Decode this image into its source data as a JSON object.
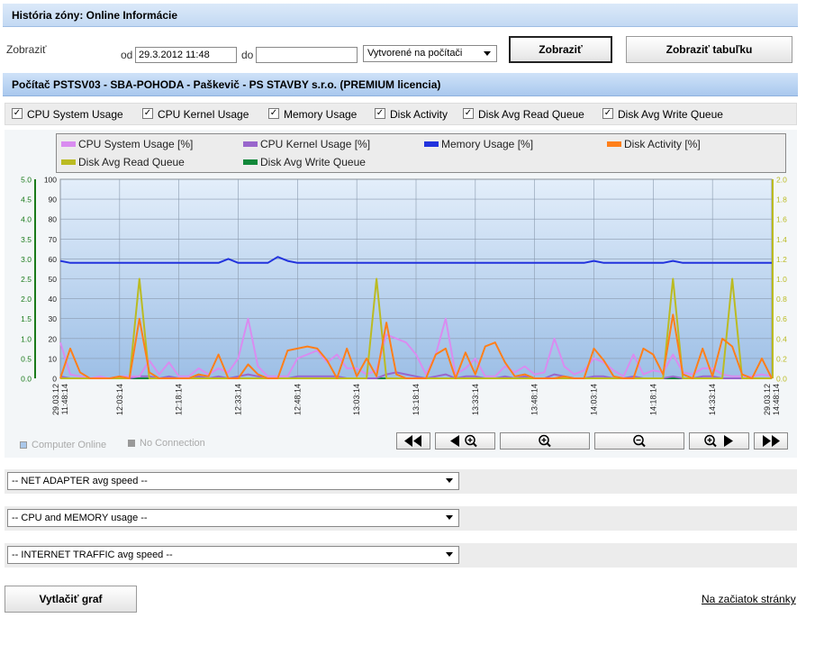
{
  "header": {
    "title": "História zóny: Online Informácie"
  },
  "filter": {
    "show_label": "Zobraziť",
    "from_label": "od",
    "from_value": "29.3.2012 11:48",
    "to_label": "do",
    "to_value": "",
    "mode_select": "Vytvorené na počítači",
    "show_button": "Zobraziť",
    "table_button": "Zobraziť tabuľku"
  },
  "computer": {
    "title": "Počítač PSTSV03 - SBA-POHODA - Paškevič - PS STAVBY s.r.o. (PREMIUM licencia)"
  },
  "checkboxes": [
    {
      "label": "CPU System Usage",
      "checked": true
    },
    {
      "label": "CPU Kernel Usage",
      "checked": true
    },
    {
      "label": "Memory Usage",
      "checked": true
    },
    {
      "label": "Disk Activity",
      "checked": true
    },
    {
      "label": "Disk Avg Read Queue",
      "checked": true
    },
    {
      "label": "Disk Avg Write Queue",
      "checked": true
    }
  ],
  "check_mark": "✓",
  "status": {
    "online": "Computer Online",
    "no_connection": "No Connection"
  },
  "colors": {
    "cpu_system": "#d98cf0",
    "cpu_kernel": "#9966cc",
    "memory": "#2233dd",
    "disk_activity": "#ff7f1a",
    "disk_read": "#bbbb22",
    "disk_write": "#11883a",
    "left_axis": "#1a7a1a",
    "right_axis": "#bbbb22"
  },
  "chart_data": {
    "type": "line",
    "legend": [
      "CPU System Usage [%]",
      "CPU Kernel Usage [%]",
      "Memory Usage [%]",
      "Disk Activity [%]",
      "Disk Avg Read Queue",
      "Disk Avg Write Queue"
    ],
    "left_axis_ticks": [
      "0.0",
      "0.5",
      "1.0",
      "1.5",
      "2.0",
      "2.5",
      "3.0",
      "3.5",
      "4.0",
      "4.5",
      "5.0"
    ],
    "percent_axis_ticks": [
      "0",
      "10",
      "20",
      "30",
      "40",
      "50",
      "60",
      "70",
      "80",
      "90",
      "100"
    ],
    "right_axis_ticks": [
      "0.0",
      "0.2",
      "0.4",
      "0.6",
      "0.8",
      "1.0",
      "1.2",
      "1.4",
      "1.6",
      "1.8",
      "2.0"
    ],
    "x_ticks": [
      "29.03.12 11:48:14",
      "12:03:14",
      "12:18:14",
      "12:33:14",
      "12:48:14",
      "13:03:14",
      "13:18:14",
      "13:33:14",
      "13:48:14",
      "14:03:14",
      "14:18:14",
      "14:33:14",
      "29.03.12 14:48:14"
    ],
    "ylim": [
      0,
      100
    ],
    "grid": true,
    "series": [
      {
        "name": "CPU System Usage [%]",
        "key": "cpu_system",
        "axis": "percent",
        "values": [
          18,
          2,
          1,
          0,
          1,
          0,
          1,
          1,
          1,
          9,
          2,
          8,
          1,
          1,
          5,
          2,
          5,
          3,
          10,
          30,
          6,
          1,
          1,
          1,
          10,
          12,
          14,
          8,
          12,
          5,
          5,
          2,
          4,
          22,
          20,
          18,
          12,
          2,
          12,
          30,
          2,
          5,
          10,
          1,
          1,
          6,
          3,
          6,
          2,
          3,
          20,
          6,
          2,
          4,
          10,
          8,
          4,
          1,
          12,
          2,
          4,
          3,
          12,
          3,
          2,
          5,
          5,
          2,
          1,
          1,
          1,
          2,
          1
        ]
      },
      {
        "name": "CPU Kernel Usage [%]",
        "key": "cpu_kernel",
        "axis": "percent",
        "values": [
          1,
          0,
          0,
          0,
          0,
          0,
          1,
          0,
          1,
          1,
          0,
          1,
          0,
          0,
          1,
          0,
          1,
          0,
          1,
          2,
          1,
          0,
          0,
          0,
          1,
          1,
          1,
          1,
          1,
          0,
          0,
          0,
          0,
          2,
          3,
          2,
          1,
          0,
          1,
          2,
          0,
          1,
          1,
          0,
          0,
          1,
          0,
          1,
          0,
          0,
          2,
          1,
          0,
          0,
          1,
          1,
          0,
          0,
          1,
          0,
          0,
          0,
          1,
          0,
          0,
          1,
          1,
          0,
          0,
          0,
          0,
          0,
          0
        ]
      },
      {
        "name": "Memory Usage [%]",
        "key": "memory",
        "axis": "percent",
        "values": [
          59,
          58,
          58,
          58,
          58,
          58,
          58,
          58,
          58,
          58,
          58,
          58,
          58,
          58,
          58,
          58,
          58,
          60,
          58,
          58,
          58,
          58,
          61,
          59,
          58,
          58,
          58,
          58,
          58,
          58,
          58,
          58,
          58,
          58,
          58,
          58,
          58,
          58,
          58,
          58,
          58,
          58,
          58,
          58,
          58,
          58,
          58,
          58,
          58,
          58,
          58,
          58,
          58,
          58,
          59,
          58,
          58,
          58,
          58,
          58,
          58,
          58,
          59,
          58,
          58,
          58,
          58,
          58,
          58,
          58,
          58,
          58,
          58
        ]
      },
      {
        "name": "Disk Activity [%]",
        "key": "disk_activity",
        "axis": "percent",
        "values": [
          0,
          15,
          3,
          0,
          0,
          0,
          1,
          0,
          30,
          3,
          0,
          0,
          0,
          0,
          2,
          1,
          12,
          0,
          0,
          7,
          2,
          0,
          0,
          14,
          15,
          16,
          15,
          9,
          0,
          15,
          1,
          10,
          1,
          28,
          2,
          0,
          0,
          0,
          12,
          15,
          0,
          13,
          2,
          16,
          18,
          8,
          1,
          2,
          0,
          0,
          0,
          1,
          0,
          0,
          15,
          9,
          1,
          0,
          0,
          15,
          12,
          2,
          32,
          2,
          0,
          15,
          1,
          20,
          16,
          2,
          0,
          10,
          0
        ]
      },
      {
        "name": "Disk Avg Read Queue",
        "key": "disk_read",
        "axis": "right",
        "values": [
          0,
          0,
          0,
          0,
          0,
          0,
          0,
          0,
          1.0,
          0,
          0,
          0,
          0,
          0,
          0,
          0,
          0,
          0,
          0,
          0,
          0,
          0,
          0,
          0,
          0,
          0,
          0,
          0,
          0,
          0,
          0,
          0,
          1.0,
          0,
          0,
          0,
          0,
          0,
          0,
          0,
          0,
          0,
          0,
          0,
          0,
          0,
          0,
          0,
          0,
          0,
          0,
          0,
          0,
          0,
          0,
          0,
          0,
          0,
          0,
          0,
          0,
          0,
          1.0,
          0,
          0,
          0,
          0,
          0,
          1.0,
          0,
          0,
          0,
          0
        ]
      },
      {
        "name": "Disk Avg Write Queue",
        "key": "disk_write",
        "axis": "right",
        "values": [
          0,
          0,
          0,
          0,
          0,
          0,
          0,
          0,
          0,
          0,
          0,
          0,
          0,
          0,
          0,
          0,
          0,
          0,
          0,
          0,
          0,
          0,
          0,
          0,
          0,
          0,
          0,
          0,
          0,
          0,
          0,
          0,
          0,
          0,
          0,
          0,
          0,
          0,
          0,
          0,
          0,
          0,
          0,
          0,
          0,
          0,
          0,
          0,
          0,
          0,
          0,
          0,
          0,
          0,
          0,
          0,
          0,
          0,
          0,
          0,
          0,
          0,
          0,
          0,
          0,
          0,
          0,
          0,
          0,
          0,
          0,
          0,
          0
        ]
      }
    ]
  },
  "nav": {
    "first": "◀◀",
    "first_icon": "double-left-icon",
    "prev": "◀",
    "prev_icon": "zoom-in-left-icon",
    "zoom_in": "zoom-in-icon",
    "zoom_out": "zoom-out-icon",
    "next": "▶",
    "next_icon": "zoom-in-right-icon",
    "last": "▶▶",
    "last_icon": "double-right-icon"
  },
  "dropdowns": [
    {
      "value": "-- NET ADAPTER avg speed --"
    },
    {
      "value": "-- CPU and MEMORY usage --"
    },
    {
      "value": "-- INTERNET TRAFFIC avg speed --"
    }
  ],
  "footer": {
    "print_button": "Vytlačiť graf",
    "top_link": "Na začiatok stránky"
  }
}
